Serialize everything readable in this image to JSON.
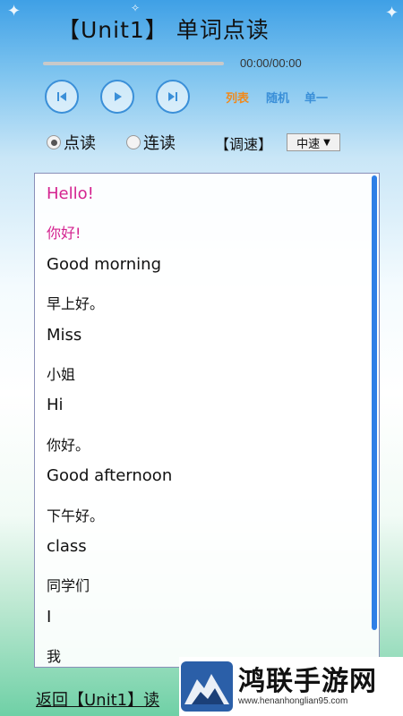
{
  "header": {
    "title": "【Unit1】 单词点读"
  },
  "player": {
    "time": "00:00/00:00",
    "progress": 0.0,
    "controls": [
      "previous",
      "play",
      "next"
    ],
    "modes": [
      {
        "label": "列表",
        "color": "#f08a1c"
      },
      {
        "label": "随机",
        "color": "#3a8fd8"
      },
      {
        "label": "单一",
        "color": "#3a8fd8"
      }
    ]
  },
  "options": {
    "read_modes": [
      {
        "label": "点读",
        "selected": true
      },
      {
        "label": "连读",
        "selected": false
      }
    ],
    "speed_label": "【调速】",
    "speed_value": "中速",
    "speed_arrow": "▼"
  },
  "words": [
    {
      "text": "Hello!",
      "lang": "en",
      "active": true
    },
    {
      "text": "你好!",
      "lang": "zh",
      "active": true
    },
    {
      "text": "Good morning",
      "lang": "en",
      "active": false
    },
    {
      "text": "早上好。",
      "lang": "zh",
      "active": false
    },
    {
      "text": "Miss",
      "lang": "en",
      "active": false
    },
    {
      "text": "小姐",
      "lang": "zh",
      "active": false
    },
    {
      "text": "Hi",
      "lang": "en",
      "active": false
    },
    {
      "text": "你好。",
      "lang": "zh",
      "active": false
    },
    {
      "text": "Good afternoon",
      "lang": "en",
      "active": false
    },
    {
      "text": "下午好。",
      "lang": "zh",
      "active": false
    },
    {
      "text": "class",
      "lang": "en",
      "active": false
    },
    {
      "text": "同学们",
      "lang": "zh",
      "active": false
    },
    {
      "text": "I",
      "lang": "en",
      "active": false
    },
    {
      "text": "我",
      "lang": "zh",
      "active": false
    }
  ],
  "footer": {
    "back_link": "返回【Unit1】读"
  },
  "watermark": {
    "name": "鸿联手游网",
    "url": "www.henanhonglian95.com"
  },
  "colors": {
    "accent": "#3a8fd8",
    "highlight": "#d4228f",
    "scrollbar": "#2f7fe6"
  }
}
